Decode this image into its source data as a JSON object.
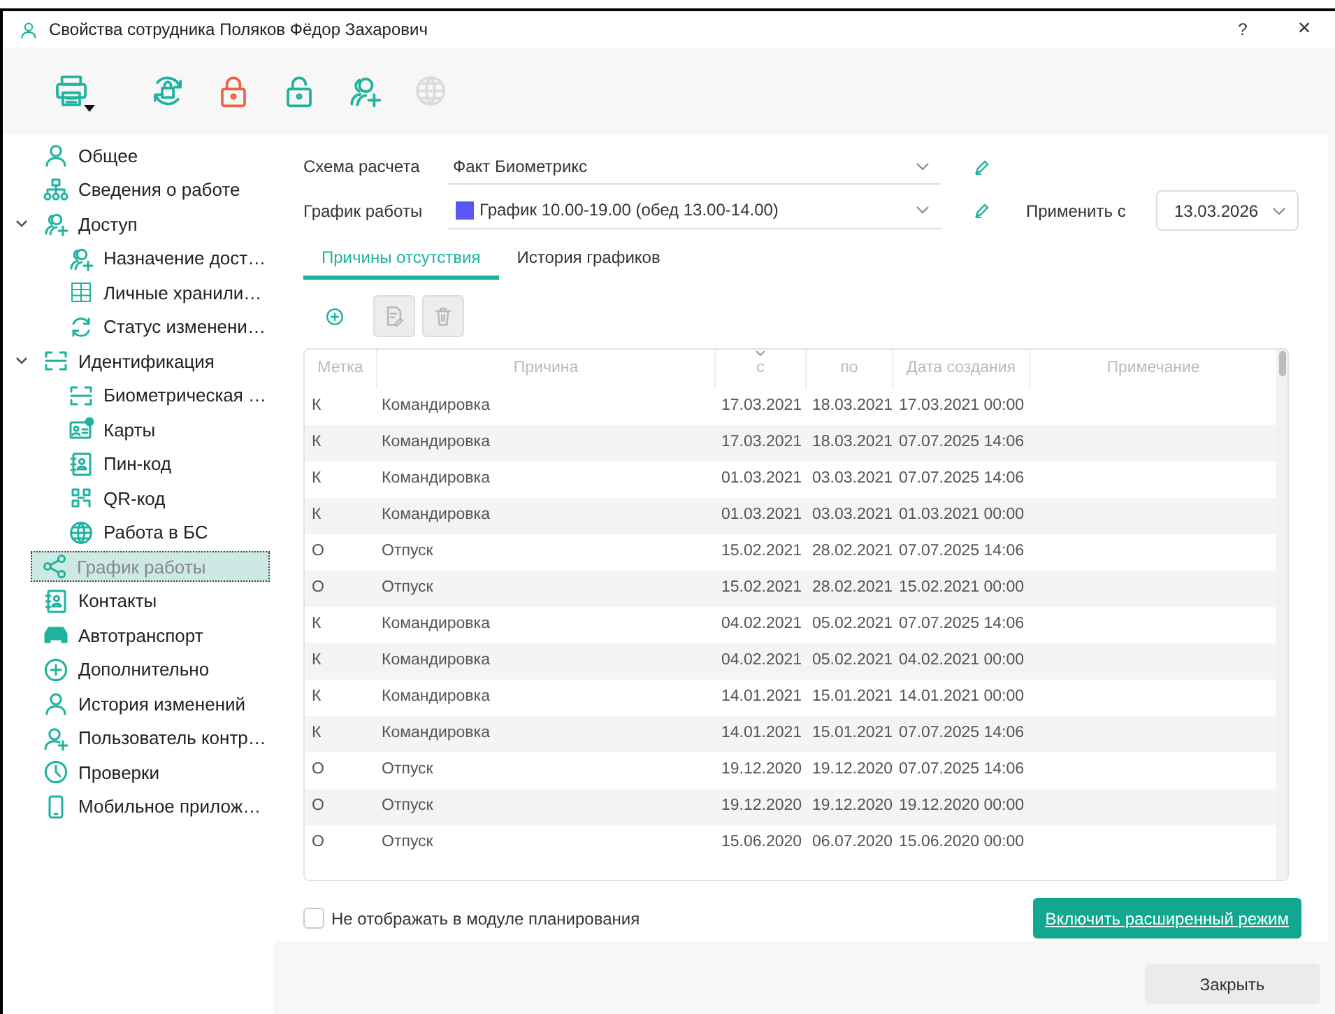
{
  "window": {
    "title": "Свойства сотрудника Поляков Фёдор Захарович",
    "help": "?",
    "close": "×"
  },
  "toolbar_buttons": [
    {
      "disabled": false
    },
    {
      "disabled": false
    },
    {
      "disabled": false
    },
    {
      "disabled": false
    },
    {
      "disabled": false
    },
    {
      "disabled": true
    }
  ],
  "sidebar": {
    "items": [
      {
        "label": "Общее",
        "selected": false
      },
      {
        "label": "Сведения о работе",
        "selected": false
      },
      {
        "label": "Доступ",
        "selected": false,
        "expanded": true,
        "children": [
          {
            "label": "Назначение дост…",
            "selected": false
          },
          {
            "label": "Личные хранили…",
            "selected": false
          },
          {
            "label": "Статус изменени…",
            "selected": false
          }
        ]
      },
      {
        "label": "Идентификация",
        "selected": false,
        "expanded": true,
        "children": [
          {
            "label": "Биометрическая …",
            "selected": false
          },
          {
            "label": "Карты",
            "selected": false
          },
          {
            "label": "Пин-код",
            "selected": false
          },
          {
            "label": "QR-код",
            "selected": false
          },
          {
            "label": "Работа в БС",
            "selected": false
          }
        ]
      },
      {
        "label": "График работы",
        "selected": true
      },
      {
        "label": "Контакты",
        "selected": false
      },
      {
        "label": "Автотранспорт",
        "selected": false
      },
      {
        "label": "Дополнительно",
        "selected": false
      },
      {
        "label": "История изменений",
        "selected": false
      },
      {
        "label": "Пользователь контр…",
        "selected": false
      },
      {
        "label": "Проверки",
        "selected": false
      },
      {
        "label": "Мобильное прилож…",
        "selected": false
      }
    ]
  },
  "form": {
    "scheme": {
      "label": "Схема расчета",
      "value": "Факт Биометрикс"
    },
    "schedule": {
      "label": "График работы",
      "value": "График 10.00-19.00 (обед 13.00-14.00)",
      "color": "#5a55f5"
    },
    "apply_from": {
      "label": "Применить с",
      "value": "13.03.2026"
    }
  },
  "tabs": [
    {
      "label": "Причины отсутствия",
      "selected": true
    },
    {
      "label": "История графиков",
      "selected": false
    }
  ],
  "table_toolbar": [
    {
      "disabled": false
    },
    {
      "disabled": true
    },
    {
      "disabled": true
    }
  ],
  "table": {
    "columns": [
      {
        "label": "Метка",
        "sorted": false
      },
      {
        "label": "Причина",
        "sorted": false
      },
      {
        "label": "с",
        "sorted": true
      },
      {
        "label": "по",
        "sorted": false
      },
      {
        "label": "Дата создания",
        "sorted": false
      },
      {
        "label": "Примечание",
        "sorted": false
      }
    ],
    "rows": [
      [
        "К",
        "Командировка",
        "17.03.2021",
        "18.03.2021",
        "17.03.2021 00:00"
      ],
      [
        "К",
        "Командировка",
        "17.03.2021",
        "18.03.2021",
        "07.07.2025 14:06"
      ],
      [
        "К",
        "Командировка",
        "01.03.2021",
        "03.03.2021",
        "07.07.2025 14:06"
      ],
      [
        "К",
        "Командировка",
        "01.03.2021",
        "03.03.2021",
        "01.03.2021 00:00"
      ],
      [
        "О",
        "Отпуск",
        "15.02.2021",
        "28.02.2021",
        "07.07.2025 14:06"
      ],
      [
        "О",
        "Отпуск",
        "15.02.2021",
        "28.02.2021",
        "15.02.2021 00:00"
      ],
      [
        "К",
        "Командировка",
        "04.02.2021",
        "05.02.2021",
        "07.07.2025 14:06"
      ],
      [
        "К",
        "Командировка",
        "04.02.2021",
        "05.02.2021",
        "04.02.2021 00:00"
      ],
      [
        "К",
        "Командировка",
        "14.01.2021",
        "15.01.2021",
        "14.01.2021 00:00"
      ],
      [
        "К",
        "Командировка",
        "14.01.2021",
        "15.01.2021",
        "07.07.2025 14:06"
      ],
      [
        "О",
        "Отпуск",
        "19.12.2020",
        "19.12.2020",
        "07.07.2025 14:06"
      ],
      [
        "О",
        "Отпуск",
        "19.12.2020",
        "19.12.2020",
        "19.12.2020 00:00"
      ],
      [
        "О",
        "Отпуск",
        "15.06.2020",
        "06.07.2020",
        "15.06.2020 00:00"
      ]
    ]
  },
  "hide_in_planning": {
    "label": "Не отображать в модуле планирования",
    "checked": false
  },
  "extended_mode_link": "Включить расширенный режим",
  "close_button": "Закрыть"
}
